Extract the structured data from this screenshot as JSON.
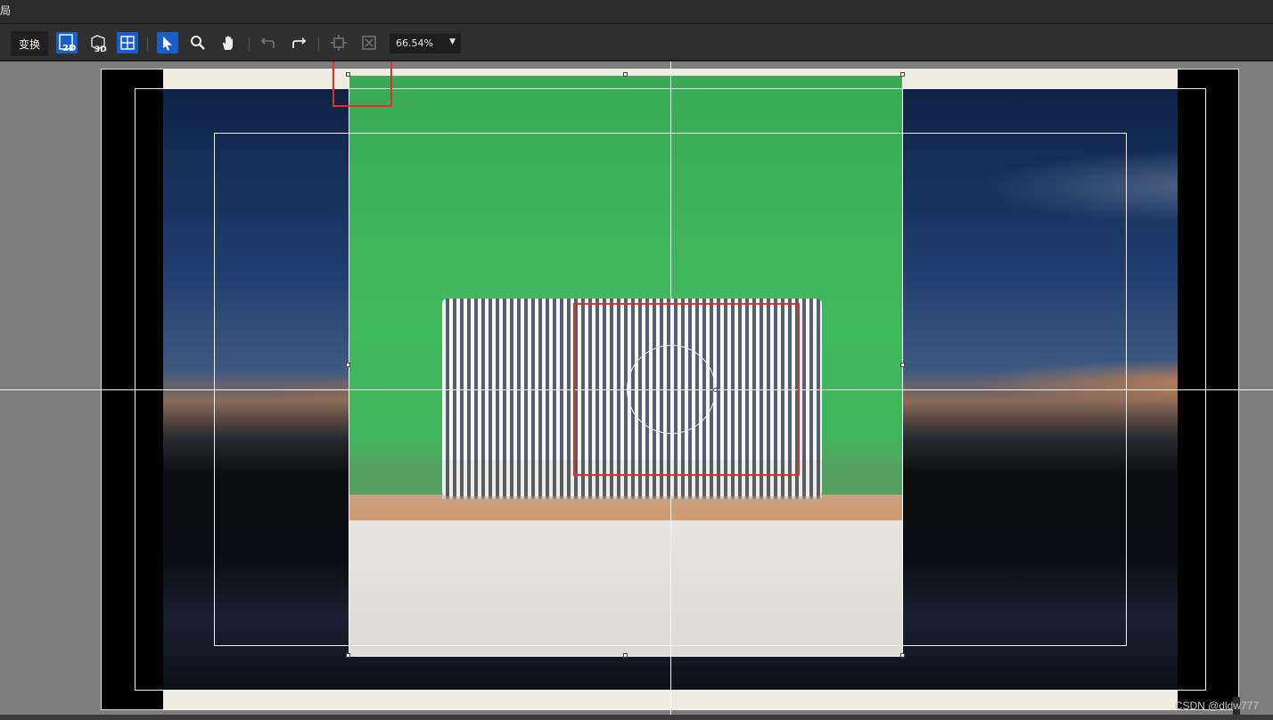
{
  "window": {
    "title_fragment": "局"
  },
  "toolbar": {
    "tab_transform": "变换",
    "zoom": {
      "value": "66.54%",
      "arrow": "▼"
    },
    "tools": [
      {
        "icon": "view-2d-icon",
        "label": "2D"
      },
      {
        "icon": "view-3d-icon",
        "label": "3D"
      },
      {
        "icon": "grid-view-icon"
      },
      {
        "icon": "select-arrow-icon",
        "active": true
      },
      {
        "icon": "zoom-magnifier-icon"
      },
      {
        "icon": "hand-pan-icon"
      },
      {
        "icon": "undo-icon",
        "disabled": true
      },
      {
        "icon": "redo-icon"
      },
      {
        "icon": "crop-icon",
        "disabled": true
      },
      {
        "icon": "fit-frame-icon",
        "disabled": true
      }
    ]
  },
  "canvas": {
    "watermark": "CSDN @dldw777"
  },
  "colors": {
    "accent_blue": "#1a5fc8",
    "highlight_red": "#e0302a",
    "toolbar_bg": "#2f2f2f",
    "canvas_bg": "#7d7d7d"
  }
}
